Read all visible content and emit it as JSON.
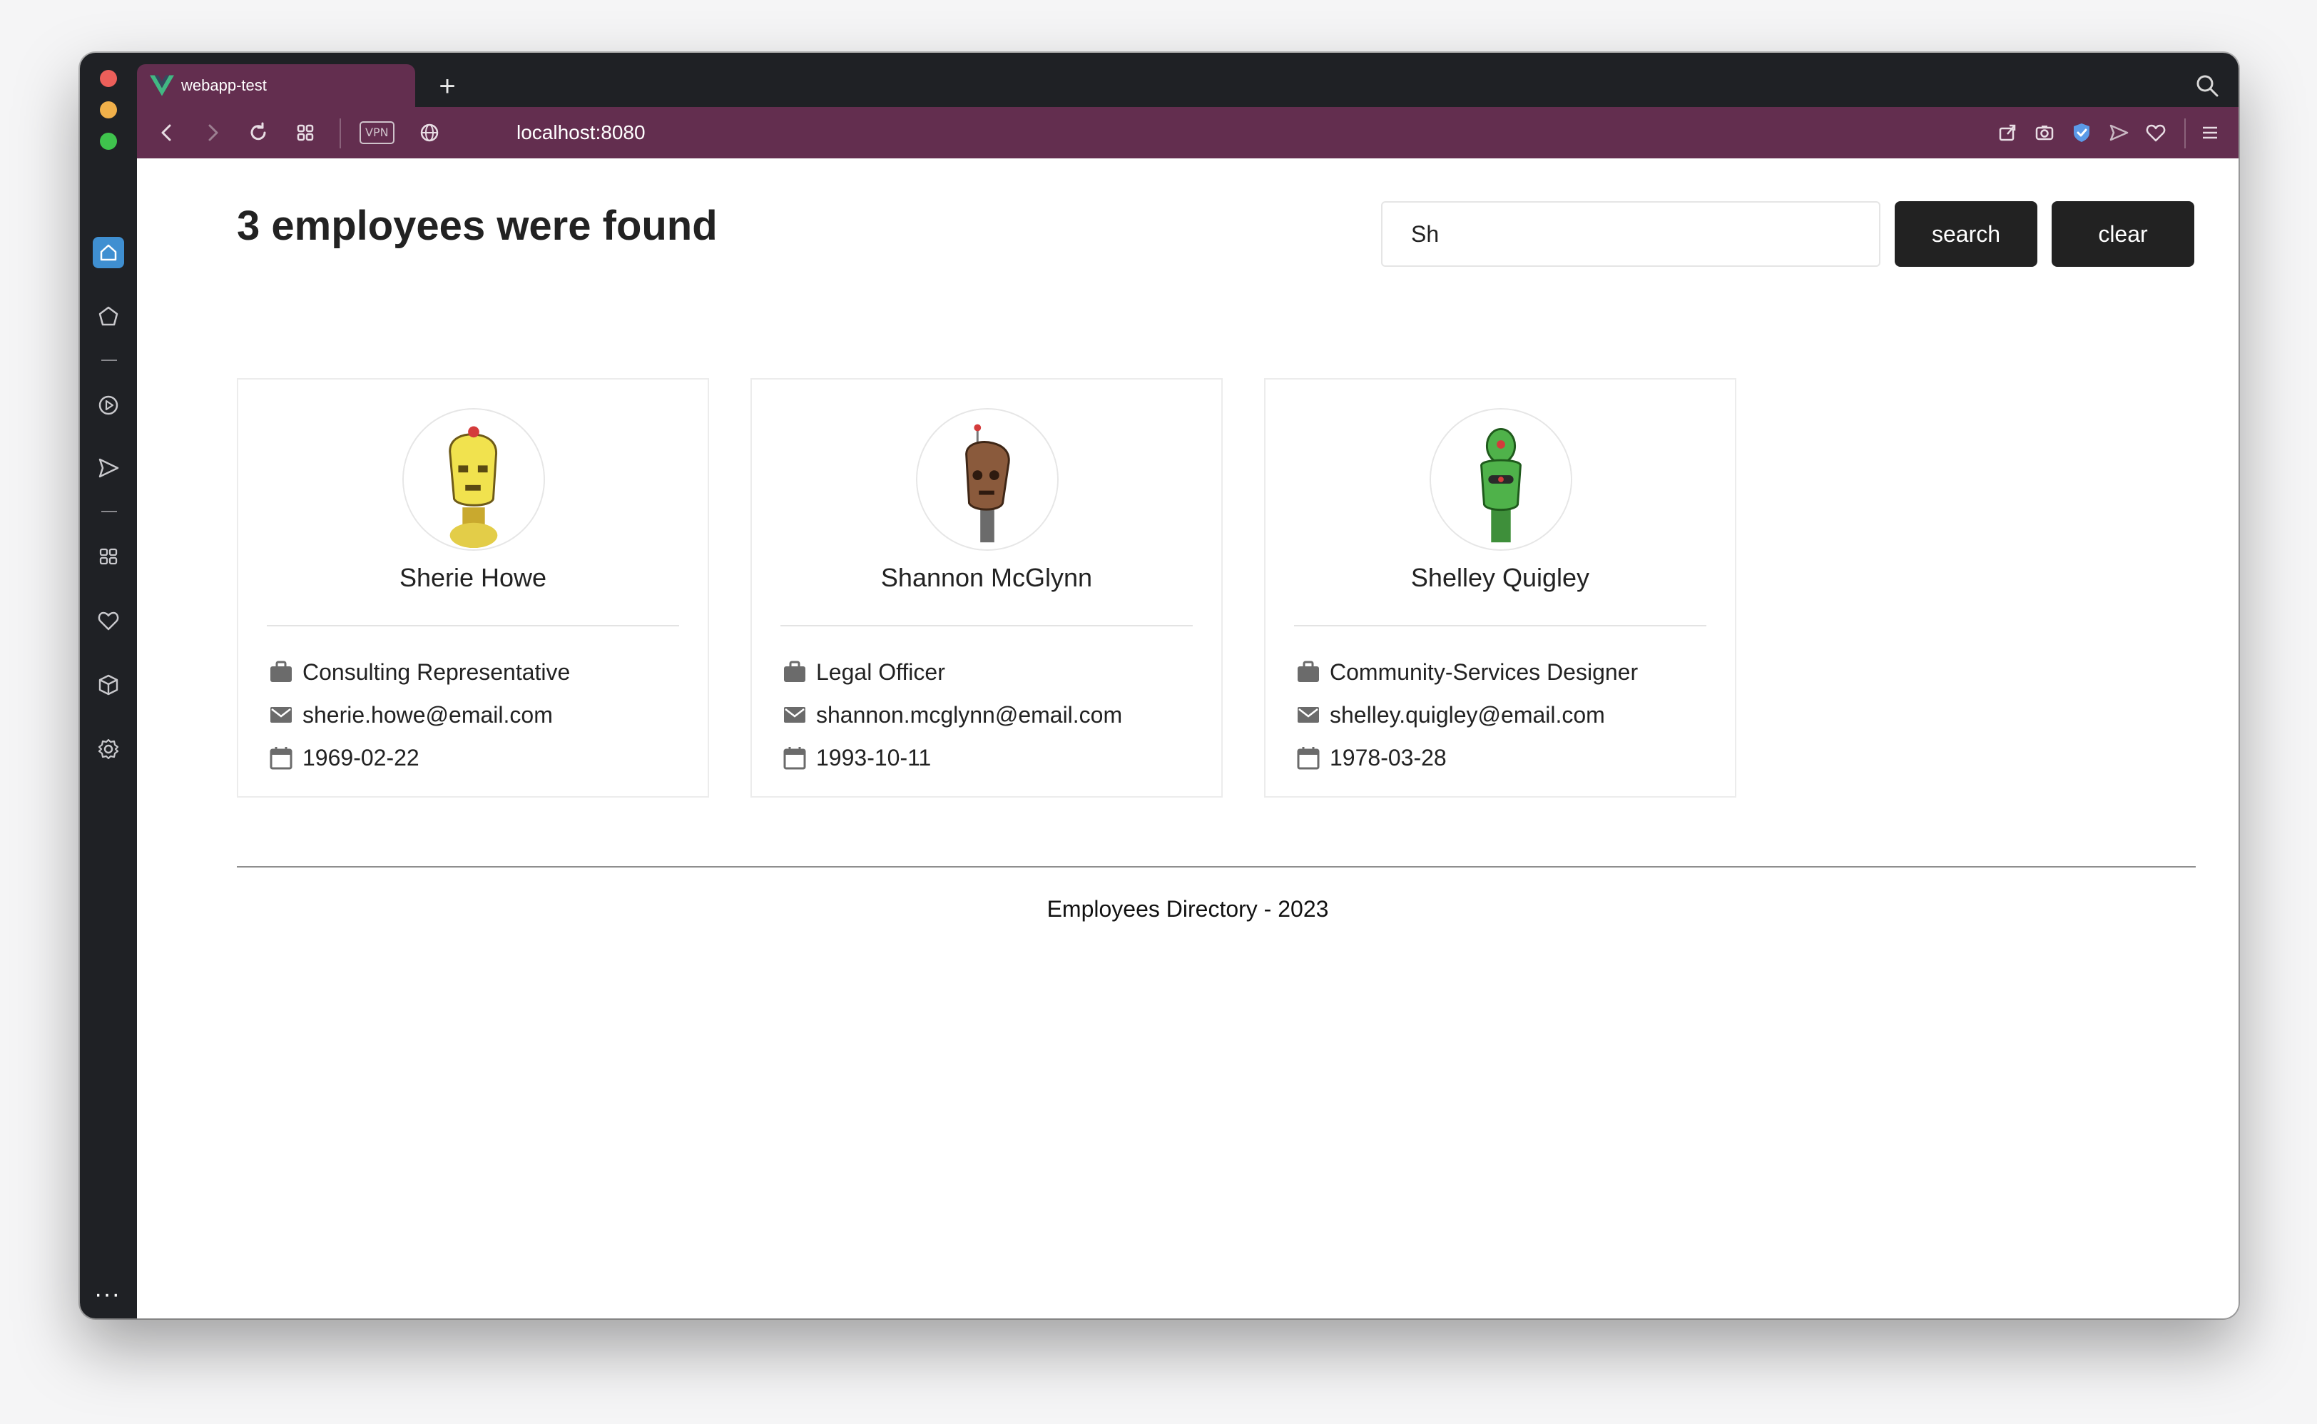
{
  "browser": {
    "tab_title": "webapp-test",
    "new_tab_symbol": "+",
    "url": "localhost:8080",
    "vpn_label": "VPN",
    "sidebar_more": "···",
    "accent_color": "#632e4f"
  },
  "page": {
    "heading": "3 employees were found",
    "search": {
      "value": "Sh",
      "search_label": "search",
      "clear_label": "clear"
    },
    "footer": "Employees Directory - 2023"
  },
  "employees": [
    {
      "name": "Sherie Howe",
      "title": "Consulting Representative",
      "email": "sherie.howe@email.com",
      "dob": "1969-02-22",
      "avatar_color": "#f1e24e"
    },
    {
      "name": "Shannon McGlynn",
      "title": "Legal Officer",
      "email": "shannon.mcglynn@email.com",
      "dob": "1993-10-11",
      "avatar_color": "#8a5a3c"
    },
    {
      "name": "Shelley Quigley",
      "title": "Community-Services Designer",
      "email": "shelley.quigley@email.com",
      "dob": "1978-03-28",
      "avatar_color": "#4fb24a"
    }
  ],
  "icons": {
    "title": "briefcase-icon",
    "email": "envelope-icon",
    "dob": "calendar-icon"
  }
}
